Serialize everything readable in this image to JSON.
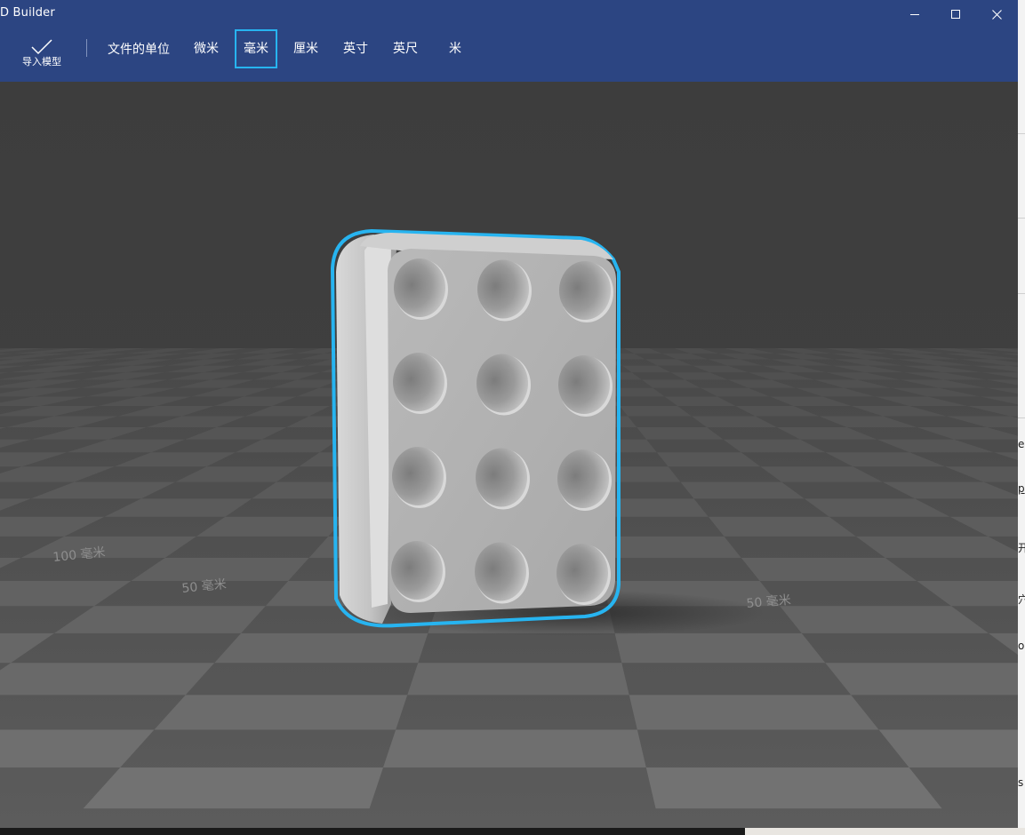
{
  "window": {
    "title": "D Builder",
    "controls": {
      "minimize_icon": "minimize-icon",
      "maximize_icon": "maximize-icon",
      "close_icon": "close-icon"
    }
  },
  "ribbon": {
    "import_label": "导入模型",
    "import_icon": "checkmark-icon",
    "units_label": "文件的单位",
    "units": [
      {
        "label": "微米",
        "selected": false
      },
      {
        "label": "毫米",
        "selected": true
      },
      {
        "label": "厘米",
        "selected": false
      },
      {
        "label": "英寸",
        "selected": false
      },
      {
        "label": "英尺",
        "selected": false
      },
      {
        "label": "米",
        "selected": false
      }
    ]
  },
  "viewport": {
    "grid_labels": [
      "100 毫米",
      "50 毫米",
      "50 毫米"
    ],
    "selection_color": "#27b4f0",
    "model": {
      "name": "model-block",
      "holes_rows": 4,
      "holes_cols": 3
    }
  },
  "background": {
    "right_fragments": [
      "e",
      "p",
      "开",
      "穴",
      "o",
      "s"
    ]
  }
}
